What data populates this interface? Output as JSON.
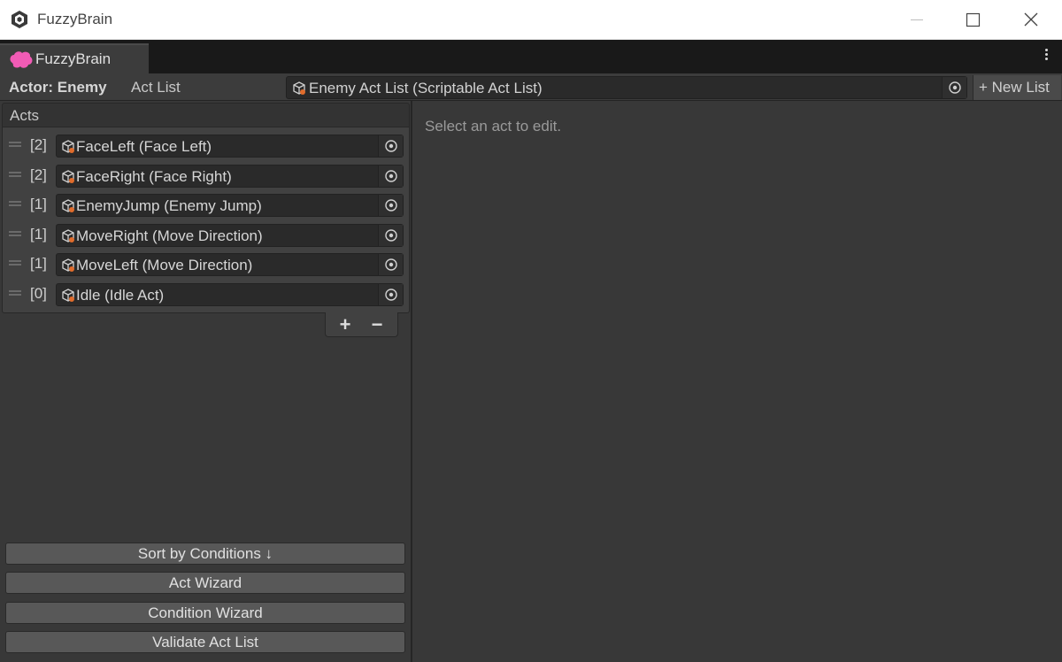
{
  "window": {
    "title": "FuzzyBrain",
    "icons": {
      "app": "unity-cube-icon",
      "minimize": "minimize-icon",
      "maximize": "maximize-icon",
      "close": "close-icon"
    }
  },
  "tab": {
    "label": "FuzzyBrain",
    "icon": "brain-icon",
    "icon_color": "#f15bb5"
  },
  "toolbar": {
    "actor_label": "Actor: Enemy",
    "act_list_label": "Act List",
    "act_list_value": "Enemy Act List (Scriptable Act List)",
    "new_list_label": "+ New List"
  },
  "acts": {
    "header": "Acts",
    "items": [
      {
        "priority": "[2]",
        "label": "FaceLeft (Face Left)"
      },
      {
        "priority": "[2]",
        "label": "FaceRight (Face Right)"
      },
      {
        "priority": "[1]",
        "label": "EnemyJump (Enemy Jump)"
      },
      {
        "priority": "[1]",
        "label": "MoveRight (Move Direction)"
      },
      {
        "priority": "[1]",
        "label": "MoveLeft (Move Direction)"
      },
      {
        "priority": "[0]",
        "label": "Idle (Idle Act)"
      }
    ],
    "add_label": "+",
    "remove_label": "−"
  },
  "buttons": {
    "sort": "Sort by Conditions ↓",
    "act_wizard": "Act Wizard",
    "condition_wizard": "Condition Wizard",
    "validate": "Validate Act List"
  },
  "detail": {
    "hint": "Select an act to edit."
  }
}
